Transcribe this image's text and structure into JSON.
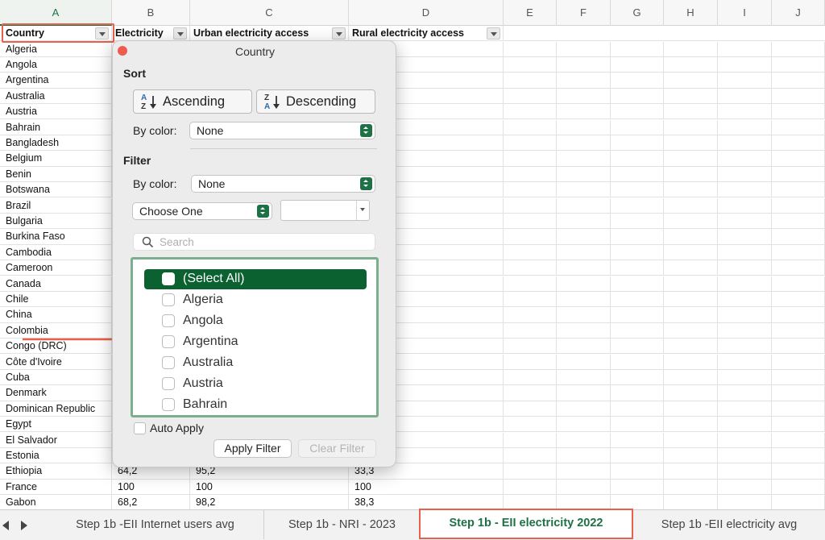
{
  "columns": [
    "A",
    "B",
    "C",
    "D",
    "E",
    "F",
    "G",
    "H",
    "I",
    "J"
  ],
  "active_column": "A",
  "header_row": [
    "Country",
    "Electricity",
    "Urban electricity access",
    "Rural electricity access"
  ],
  "rows": [
    {
      "a": "Algeria",
      "b": "",
      "c": "",
      "d": ""
    },
    {
      "a": "Angola",
      "b": "",
      "c": "",
      "d": ""
    },
    {
      "a": "Argentina",
      "b": "",
      "c": "",
      "d": ""
    },
    {
      "a": "Australia",
      "b": "",
      "c": "",
      "d": ""
    },
    {
      "a": "Austria",
      "b": "",
      "c": "",
      "d": ""
    },
    {
      "a": "Bahrain",
      "b": "",
      "c": "",
      "d": ""
    },
    {
      "a": "Bangladesh",
      "b": "",
      "c": "",
      "d": ""
    },
    {
      "a": "Belgium",
      "b": "",
      "c": "",
      "d": ""
    },
    {
      "a": "Benin",
      "b": "",
      "c": "",
      "d": ""
    },
    {
      "a": "Botswana",
      "b": "",
      "c": "",
      "d": ""
    },
    {
      "a": "Brazil",
      "b": "",
      "c": "",
      "d": ""
    },
    {
      "a": "Bulgaria",
      "b": "",
      "c": "",
      "d": ""
    },
    {
      "a": "Burkina Faso",
      "b": "",
      "c": "",
      "d": ""
    },
    {
      "a": "Cambodia",
      "b": "",
      "c": "",
      "d": ""
    },
    {
      "a": "Cameroon",
      "b": "",
      "c": "",
      "d": ""
    },
    {
      "a": "Canada",
      "b": "",
      "c": "",
      "d": ""
    },
    {
      "a": "Chile",
      "b": "",
      "c": "",
      "d": ""
    },
    {
      "a": "China",
      "b": "",
      "c": "",
      "d": ""
    },
    {
      "a": "Colombia",
      "b": "",
      "c": "",
      "d": ""
    },
    {
      "a": "Congo (DRC)",
      "b": "",
      "c": "",
      "d": ""
    },
    {
      "a": "Côte d'Ivoire",
      "b": "",
      "c": "",
      "d": ""
    },
    {
      "a": "Cuba",
      "b": "",
      "c": "",
      "d": ""
    },
    {
      "a": "Denmark",
      "b": "",
      "c": "",
      "d": ""
    },
    {
      "a": "Dominican Republic",
      "b": "",
      "c": "",
      "d": ""
    },
    {
      "a": "Egypt",
      "b": "",
      "c": "",
      "d": ""
    },
    {
      "a": "El Salvador",
      "b": "",
      "c": "",
      "d": ""
    },
    {
      "a": "Estonia",
      "b": "",
      "c": "",
      "d": ""
    },
    {
      "a": "Ethiopia",
      "b": "64,2",
      "c": "95,2",
      "d": "33,3"
    },
    {
      "a": "France",
      "b": "100",
      "c": "100",
      "d": "100"
    },
    {
      "a": "Gabon",
      "b": "68,2",
      "c": "98,2",
      "d": "38,3"
    }
  ],
  "popover": {
    "title": "Country",
    "sort_title": "Sort",
    "ascending_label": "Ascending",
    "descending_label": "Descending",
    "sort_by_color_label": "By color:",
    "sort_color_value": "None",
    "filter_title": "Filter",
    "filter_by_color_label": "By color:",
    "filter_color_value": "None",
    "condition_value": "Choose One",
    "condition_input_value": "",
    "search_placeholder": "Search",
    "list_items": [
      "(Select All)",
      "Algeria",
      "Angola",
      "Argentina",
      "Australia",
      "Austria",
      "Bahrain"
    ],
    "auto_apply_label": "Auto Apply",
    "apply_label": "Apply Filter",
    "clear_label": "Clear Filter"
  },
  "tabs": [
    "Step 1b -EII Internet users avg",
    "Step 1b - NRI - 2023",
    "Step 1b - EII electricity 2022",
    "Step 1b -EII electricity avg"
  ],
  "active_tab_index": 2,
  "colors": {
    "accent_green": "#1e7145",
    "highlight_red": "#e8614c",
    "selected_item": "#0b6230"
  }
}
